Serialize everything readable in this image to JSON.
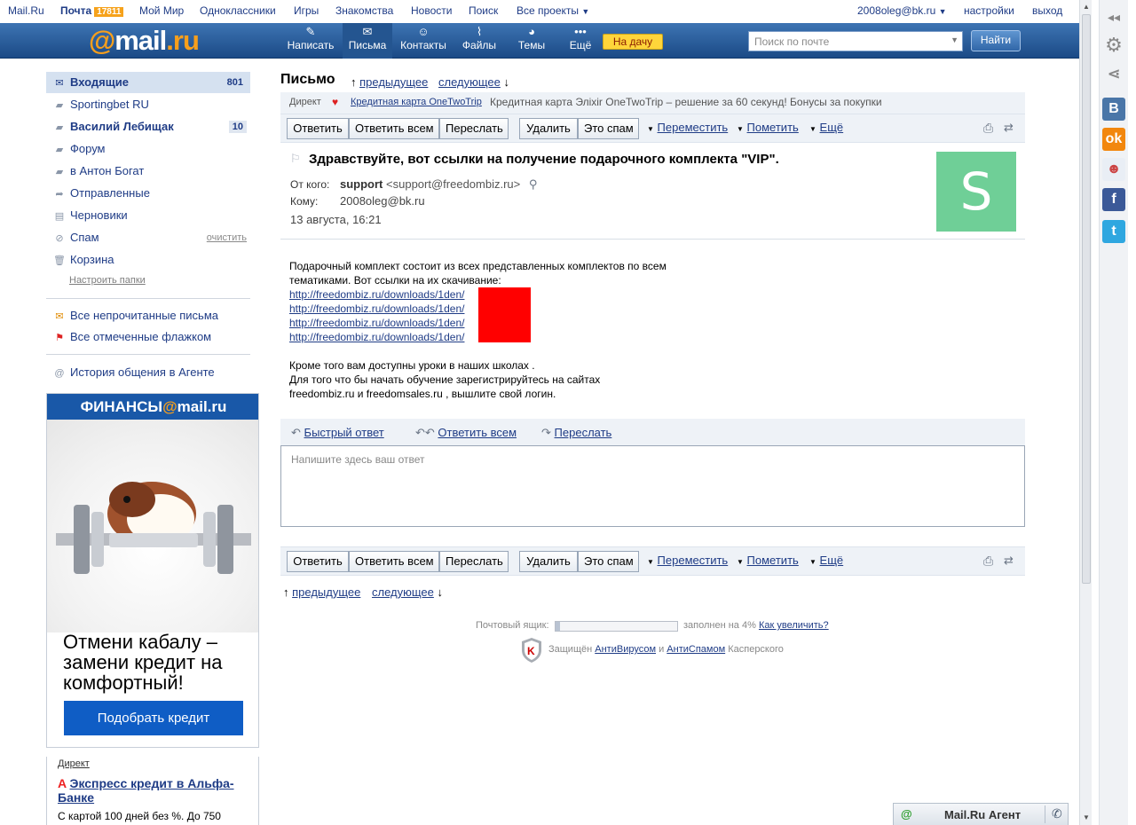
{
  "topbar": {
    "links": [
      "Mail.Ru",
      "Почта",
      "Мой Мир",
      "Одноклассники",
      "Игры",
      "Знакомства",
      "Новости",
      "Поиск",
      "Все проекты"
    ],
    "mail_badge": "17811",
    "user": "2008oleg@bk.ru",
    "settings": "настройки",
    "logout": "выход"
  },
  "logo": {
    "at": "@",
    "mail": "mail",
    "dot": ".",
    "ru": "ru"
  },
  "nav": {
    "compose": "Написать",
    "letters": "Письма",
    "contacts": "Контакты",
    "files": "Файлы",
    "themes": "Темы",
    "more": "Ещё",
    "promo": "На дачу"
  },
  "search": {
    "placeholder": "Поиск по почте",
    "button": "Найти"
  },
  "sidebar": {
    "folders": [
      {
        "label": "Входящие",
        "count": "801",
        "icon": "envelope-icon"
      },
      {
        "label": "Sportingbet RU",
        "count": "",
        "icon": "folder-icon"
      },
      {
        "label": "Василий Лебищак",
        "count": "10",
        "icon": "folder-icon"
      },
      {
        "label": "Форум",
        "count": "",
        "icon": "folder-icon"
      },
      {
        "label": "в Антон Богат",
        "count": "",
        "icon": "folder-icon"
      },
      {
        "label": "Отправленные",
        "count": "",
        "icon": "sent-icon"
      },
      {
        "label": "Черновики",
        "count": "",
        "icon": "draft-icon"
      },
      {
        "label": "Спам",
        "count": "",
        "icon": "spam-icon",
        "action": "очистить"
      },
      {
        "label": "Корзина",
        "count": "",
        "icon": "trash-icon"
      }
    ],
    "configure": "Настроить папки",
    "unread": "Все непрочитанные письма",
    "flagged": "Все отмеченные флажком",
    "agent_history": "История общения в Агенте"
  },
  "ad": {
    "brand_pre": "ФИНАНСЫ",
    "brand_at": "@",
    "brand_post": "mail.ru",
    "title": "Отмени кабалу – замени кредит на комфортный!",
    "button": "Подобрать кредит"
  },
  "direct_ad": {
    "label": "Директ",
    "title": "Экспресс кредит в Альфа-Банке",
    "text": "С картой 100 дней без %. До 750"
  },
  "letter": {
    "heading": "Письмо",
    "prev": "предыдущее",
    "next": "следующее",
    "direct_label": "Директ",
    "direct_link": "Кредитная карта OneTwoTrip",
    "direct_text": "Кредитная карта Элixir OneTwoTrip – решение за 60 секунд! Бонусы за покупки",
    "subject": "Здравствуйте, вот ссылки на получение подарочного комплекта \"VIP\".",
    "from_label": "От кого:",
    "from_name": "support",
    "from_addr": "<support@freedombiz.ru>",
    "to_label": "Кому:",
    "to_addr": "2008oleg@bk.ru",
    "date": "13 августа, 16:21",
    "avatar_letter": "S",
    "body_line1": "Подарочный комплект состоит из всех представленных комплектов по всем",
    "body_line2": "тематиками. Вот ссылки на их скачивание:",
    "links": [
      "http://freedombiz.ru/downloads/1den/",
      "http://freedombiz.ru/downloads/1den/",
      "http://freedombiz.ru/downloads/1den/",
      "http://freedombiz.ru/downloads/1den/"
    ],
    "body_line3": "Кроме того вам доступны уроки в наших школах .",
    "body_line4": "Для того что бы начать обучение зарегистрируйтесь на сайтах",
    "body_line5": "freedombiz.ru и freedomsales.ru , вышлите свой логин."
  },
  "toolbar": {
    "reply": "Ответить",
    "reply_all": "Ответить всем",
    "forward": "Переслать",
    "delete": "Удалить",
    "spam": "Это спам",
    "move": "Переместить",
    "mark": "Пометить",
    "more": "Ещё"
  },
  "quick": {
    "quick_reply": "Быстрый ответ",
    "reply_all": "Ответить всем",
    "forward": "Переслать",
    "placeholder": "Напишите здесь ваш ответ"
  },
  "footer": {
    "mailbox_label": "Почтовый ящик:",
    "filled": "заполнен на 4%",
    "filled_value": 4,
    "increase": "Как увеличить?",
    "protected_pre": "Защищён",
    "antivirus": "АнтиВирусом",
    "and": "и",
    "antispam": "АнтиСпамом",
    "kaspersky": "Касперского"
  },
  "agent": {
    "label": "Mail.Ru Агент"
  },
  "colors": {
    "accent": "#1f3c86",
    "header": "#2a5d9f",
    "avatar": "#6fcf97",
    "redacted": "#ff0000"
  }
}
